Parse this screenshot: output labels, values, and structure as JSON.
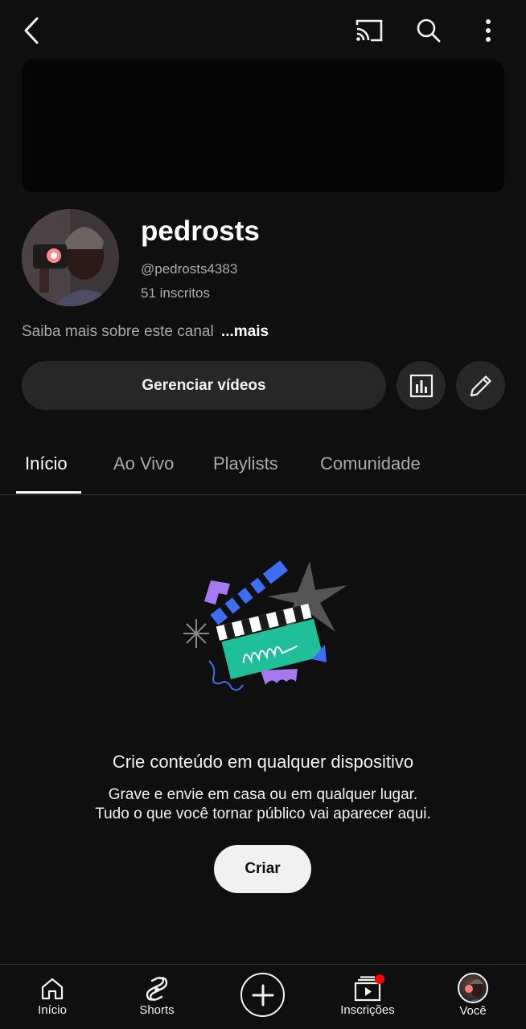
{
  "header": {
    "back_icon": "chevron-left-icon",
    "cast_icon": "cast-icon",
    "search_icon": "search-icon",
    "more_icon": "more-vertical-icon"
  },
  "channel": {
    "name": "pedrosts",
    "handle": "@pedrosts4383",
    "subscribers": "51 inscritos",
    "about_text": "Saiba mais sobre este canal",
    "about_more": "...mais"
  },
  "actions": {
    "manage_label": "Gerenciar vídeos",
    "stats_icon": "bar-chart-icon",
    "edit_icon": "pencil-icon"
  },
  "tabs": [
    {
      "label": "Início",
      "active": true
    },
    {
      "label": "Ao Vivo",
      "active": false
    },
    {
      "label": "Playlists",
      "active": false
    },
    {
      "label": "Comunidade",
      "active": false
    }
  ],
  "empty_state": {
    "title": "Crie conteúdo em qualquer dispositivo",
    "line1": "Grave e envie em casa ou em qualquer lugar.",
    "line2": "Tudo o que você tornar público vai aparecer aqui.",
    "button": "Criar"
  },
  "bottom_nav": [
    {
      "label": "Início",
      "icon": "home-icon"
    },
    {
      "label": "Shorts",
      "icon": "shorts-icon"
    },
    {
      "label": "",
      "icon": "create-plus-icon"
    },
    {
      "label": "Inscrições",
      "icon": "subscriptions-icon"
    },
    {
      "label": "Você",
      "icon": "avatar"
    }
  ],
  "colors": {
    "background": "#0f0f0f",
    "surface": "#272727",
    "text_primary": "#f1f1f1",
    "text_secondary": "#aaaaaa",
    "notification": "#ff0000",
    "illustration_green": "#1fbf9a",
    "illustration_blue": "#3d6ef5",
    "illustration_purple": "#a57af0",
    "illustration_gray": "#555555"
  }
}
